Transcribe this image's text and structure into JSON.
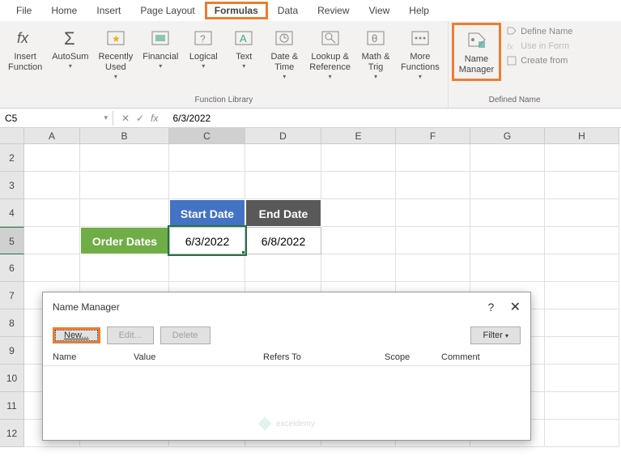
{
  "menu": {
    "items": [
      "File",
      "Home",
      "Insert",
      "Page Layout",
      "Formulas",
      "Data",
      "Review",
      "View",
      "Help"
    ],
    "active_index": 4
  },
  "ribbon": {
    "group1_label": "Function Library",
    "group2_label": "Defined Name",
    "insert_function": "Insert\nFunction",
    "autosum": "AutoSum",
    "recently_used": "Recently\nUsed",
    "financial": "Financial",
    "logical": "Logical",
    "text": "Text",
    "date_time": "Date &\nTime",
    "lookup_ref": "Lookup &\nReference",
    "math_trig": "Math &\nTrig",
    "more_functions": "More\nFunctions",
    "name_manager": "Name\nManager",
    "define_name": "Define Name",
    "use_in_formula": "Use in Form",
    "create_from": "Create from"
  },
  "namebox": "C5",
  "formula": "6/3/2022",
  "columns": [
    "A",
    "B",
    "C",
    "D",
    "E",
    "F",
    "G",
    "H"
  ],
  "rows": [
    "2",
    "3",
    "4",
    "5",
    "6",
    "7",
    "8",
    "9",
    "10",
    "11",
    "12"
  ],
  "cells": {
    "b5": "Order Dates",
    "c4": "Start Date",
    "d4": "End Date",
    "c5": "6/3/2022",
    "d5": "6/8/2022"
  },
  "dialog": {
    "title": "Name Manager",
    "new": "New...",
    "edit": "Edit...",
    "delete": "Delete",
    "filter": "Filter",
    "cols": {
      "name": "Name",
      "value": "Value",
      "refers": "Refers To",
      "scope": "Scope",
      "comment": "Comment"
    },
    "watermark": "exceldemy"
  }
}
